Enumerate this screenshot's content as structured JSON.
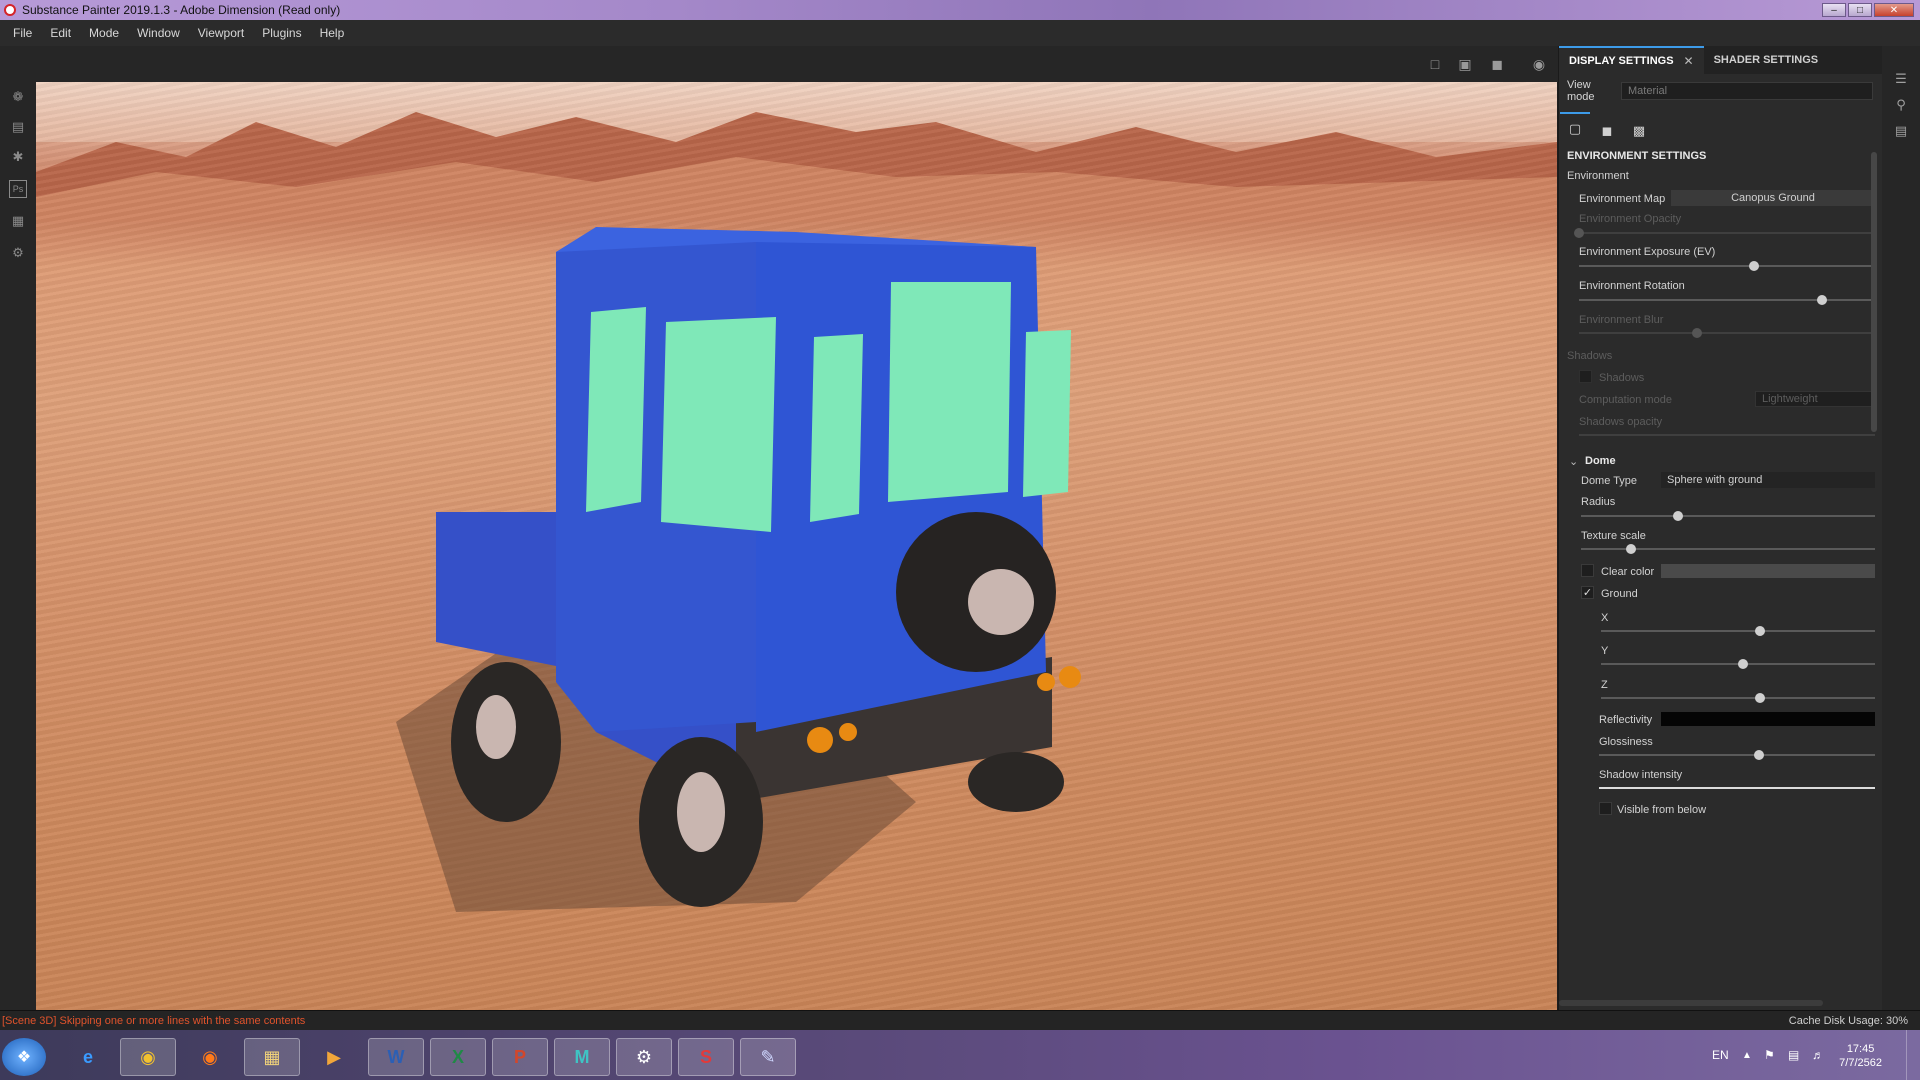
{
  "window": {
    "title": "Substance Painter 2019.1.3 - Adobe Dimension (Read only)",
    "minimize": "–",
    "maximize": "□",
    "close": "✕"
  },
  "menu": [
    "File",
    "Edit",
    "Mode",
    "Window",
    "Viewport",
    "Plugins",
    "Help"
  ],
  "panel": {
    "tab_display": "DISPLAY SETTINGS",
    "tab_shader": "SHADER SETTINGS",
    "tab_close": "✕",
    "view_mode_label": "View mode",
    "view_mode_value": "Material",
    "environment_settings_title": "ENVIRONMENT SETTINGS",
    "environment_label": "Environment",
    "environment_map_label": "Environment Map",
    "environment_map_value": "Canopus Ground",
    "environment_opacity_label": "Environment Opacity",
    "environment_opacity": 0.0,
    "environment_exposure_label": "Environment Exposure (EV)",
    "environment_exposure": 0.59,
    "environment_rotation_label": "Environment Rotation",
    "environment_rotation": 0.82,
    "environment_blur_label": "Environment Blur",
    "environment_blur": 0.4,
    "shadows_section": "Shadows",
    "shadows_checkbox_label": "Shadows",
    "computation_mode_label": "Computation mode",
    "computation_mode_value": "Lightweight",
    "shadows_opacity_label": "Shadows opacity",
    "dome_title": "Dome",
    "dome_type_label": "Dome Type",
    "dome_type_value": "Sphere with ground",
    "radius_label": "Radius",
    "radius": 0.33,
    "texture_scale_label": "Texture scale",
    "texture_scale": 0.17,
    "clear_color_label": "Clear color",
    "ground_label": "Ground",
    "ground_checked": "✓",
    "x_label": "X",
    "x_value": 0.58,
    "y_label": "Y",
    "y_value": 0.52,
    "z_label": "Z",
    "z_value": 0.58,
    "reflectivity_label": "Reflectivity",
    "glossiness_label": "Glossiness",
    "glossiness": 0.58,
    "shadow_intensity_label": "Shadow intensity",
    "shadow_intensity": 1.0,
    "visible_from_below_label": "Visible from below"
  },
  "status": {
    "message": "[Scene 3D] Skipping one or more lines with the same contents",
    "cache": "Cache Disk Usage:   30%"
  },
  "taskbar": {
    "language": "EN",
    "time": "17:45",
    "date": "7/7/2562"
  },
  "colors": {
    "accent": "#3d9be9",
    "status_error": "#e0532c",
    "jeep_body": "#2f55d4",
    "jeep_windows": "#7fe8b8"
  }
}
